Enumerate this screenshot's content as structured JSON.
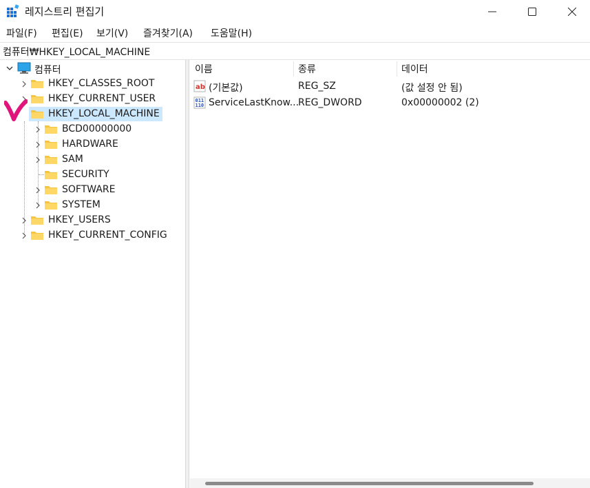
{
  "window": {
    "title": "레지스트리 편집기"
  },
  "menu": [
    "파일(F)",
    "편집(E)",
    "보기(V)",
    "즐겨찾기(A)",
    "도움말(H)"
  ],
  "address": "컴퓨터₩HKEY_LOCAL_MACHINE",
  "tree": {
    "root": "컴퓨터",
    "hives": {
      "classes_root": "HKEY_CLASSES_ROOT",
      "current_user": "HKEY_CURRENT_USER",
      "local_machine": "HKEY_LOCAL_MACHINE",
      "users": "HKEY_USERS",
      "current_config": "HKEY_CURRENT_CONFIG"
    },
    "local_machine_children": [
      "BCD00000000",
      "HARDWARE",
      "SAM",
      "SECURITY",
      "SOFTWARE",
      "SYSTEM"
    ]
  },
  "list": {
    "columns": [
      "이름",
      "종류",
      "데이터"
    ],
    "rows": [
      {
        "name": "(기본값)",
        "type": "REG_SZ",
        "data": "(값 설정 안 됨)",
        "icon": "string-value-icon"
      },
      {
        "name": "ServiceLastKnow...",
        "type": "REG_DWORD",
        "data": "0x00000002 (2)",
        "icon": "binary-value-icon"
      }
    ]
  },
  "colors": {
    "selection": "#cce8ff",
    "folder": "#f5c542",
    "annotation": "#e0147a"
  }
}
